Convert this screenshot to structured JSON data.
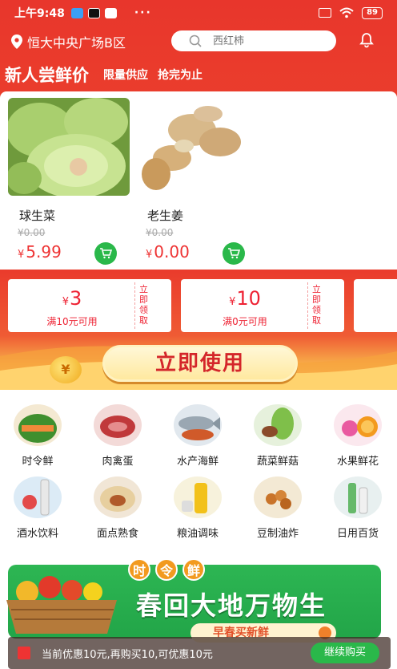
{
  "status_bar": {
    "time": "上午9:48",
    "dots": "···",
    "battery": "89"
  },
  "header": {
    "location": "恒大中央广场B区",
    "search_placeholder": "西红柿"
  },
  "promo": {
    "title": "新人尝鲜价",
    "tag1": "限量供应",
    "tag2": "抢完为止"
  },
  "products": [
    {
      "name": "球生菜",
      "old_price": "¥0.00",
      "currency": "¥",
      "price": "5.99"
    },
    {
      "name": "老生姜",
      "old_price": "¥0.00",
      "currency": "¥",
      "price": "0.00"
    }
  ],
  "coupons": [
    {
      "currency": "¥",
      "amount": "3",
      "condition": "满10元可用",
      "claim": "立即领取"
    },
    {
      "currency": "¥",
      "amount": "10",
      "condition": "满0元可用",
      "claim": "立即领取"
    }
  ],
  "use_button": "立即使用",
  "coin_symbol": "¥",
  "categories": [
    {
      "label": "时令鲜",
      "icon": "melon-icon"
    },
    {
      "label": "肉禽蛋",
      "icon": "meat-icon"
    },
    {
      "label": "水产海鲜",
      "icon": "fish-icon"
    },
    {
      "label": "蔬菜鲜菇",
      "icon": "cabbage-icon"
    },
    {
      "label": "水果鲜花",
      "icon": "fruit-flower-icon"
    },
    {
      "label": "酒水饮料",
      "icon": "drink-icon"
    },
    {
      "label": "面点熟食",
      "icon": "bun-icon"
    },
    {
      "label": "粮油调味",
      "icon": "oil-icon"
    },
    {
      "label": "豆制油炸",
      "icon": "tofu-icon"
    },
    {
      "label": "日用百货",
      "icon": "daily-goods-icon"
    }
  ],
  "banner": {
    "tag": [
      "时",
      "令",
      "鲜"
    ],
    "title": "春回大地万物生",
    "subtitle": "早春买新鲜"
  },
  "cart_toast": {
    "text": "当前优惠10元,再购买10,可优惠10元",
    "button": "继续购买"
  },
  "colors": {
    "brand_red": "#e8362c",
    "green": "#2ab84a",
    "price_red": "#e33"
  }
}
